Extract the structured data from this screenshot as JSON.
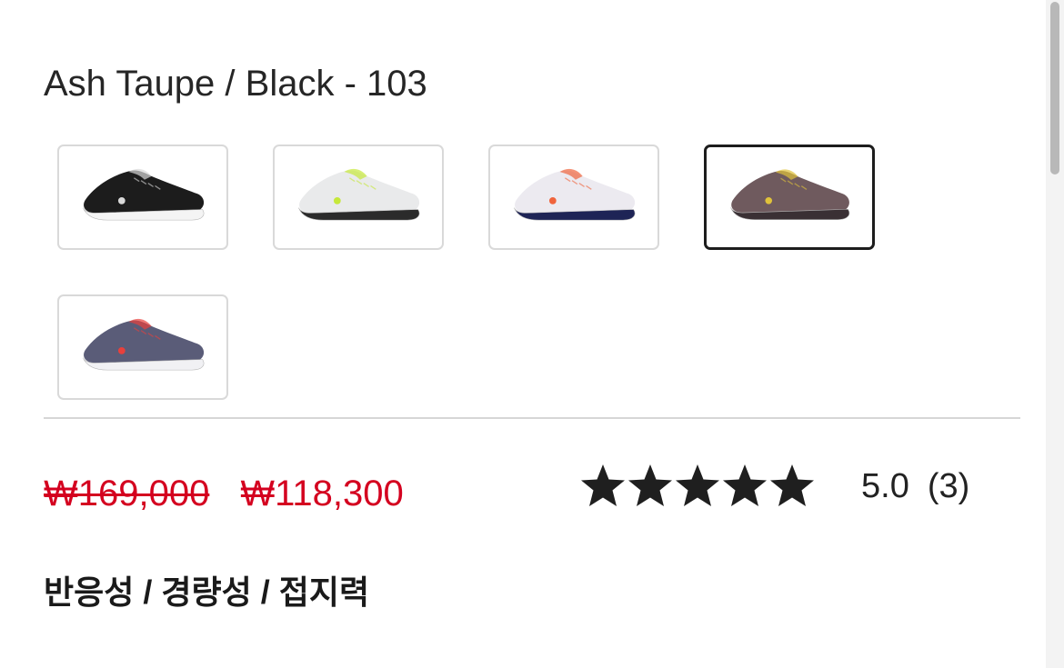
{
  "product": {
    "color_name": "Ash Taupe / Black - 103",
    "swatches": [
      {
        "name": "black-white-shoe",
        "upper": "#1c1c1c",
        "sole": "#f4f4f4",
        "accent": "#d9d9d9",
        "selected": false
      },
      {
        "name": "white-volt-shoe",
        "upper": "#e9eaeb",
        "sole": "#2b2b2b",
        "accent": "#c6e83a",
        "selected": false
      },
      {
        "name": "white-navy-orange-shoe",
        "upper": "#eceaf0",
        "sole": "#1e2456",
        "accent": "#f0643c",
        "selected": false
      },
      {
        "name": "ash-taupe-shoe",
        "upper": "#6f5a5e",
        "sole": "#3a3034",
        "accent": "#e0c23a",
        "selected": true
      },
      {
        "name": "grey-blue-red-shoe",
        "upper": "#5a5c78",
        "sole": "#f1f1f4",
        "accent": "#e8403c",
        "selected": false
      }
    ],
    "price": {
      "original": "₩169,000",
      "sale": "₩118,300",
      "color": "#d4001f"
    },
    "rating": {
      "stars": 5,
      "value": "5.0",
      "count": "(3)"
    },
    "features": "반응성 / 경량성 / 접지력"
  },
  "colors": {
    "selected_border": "#1d1d1d",
    "swatch_border": "#d9d9d9",
    "divider": "#d6d6d6",
    "star": "#1f1f1f"
  }
}
